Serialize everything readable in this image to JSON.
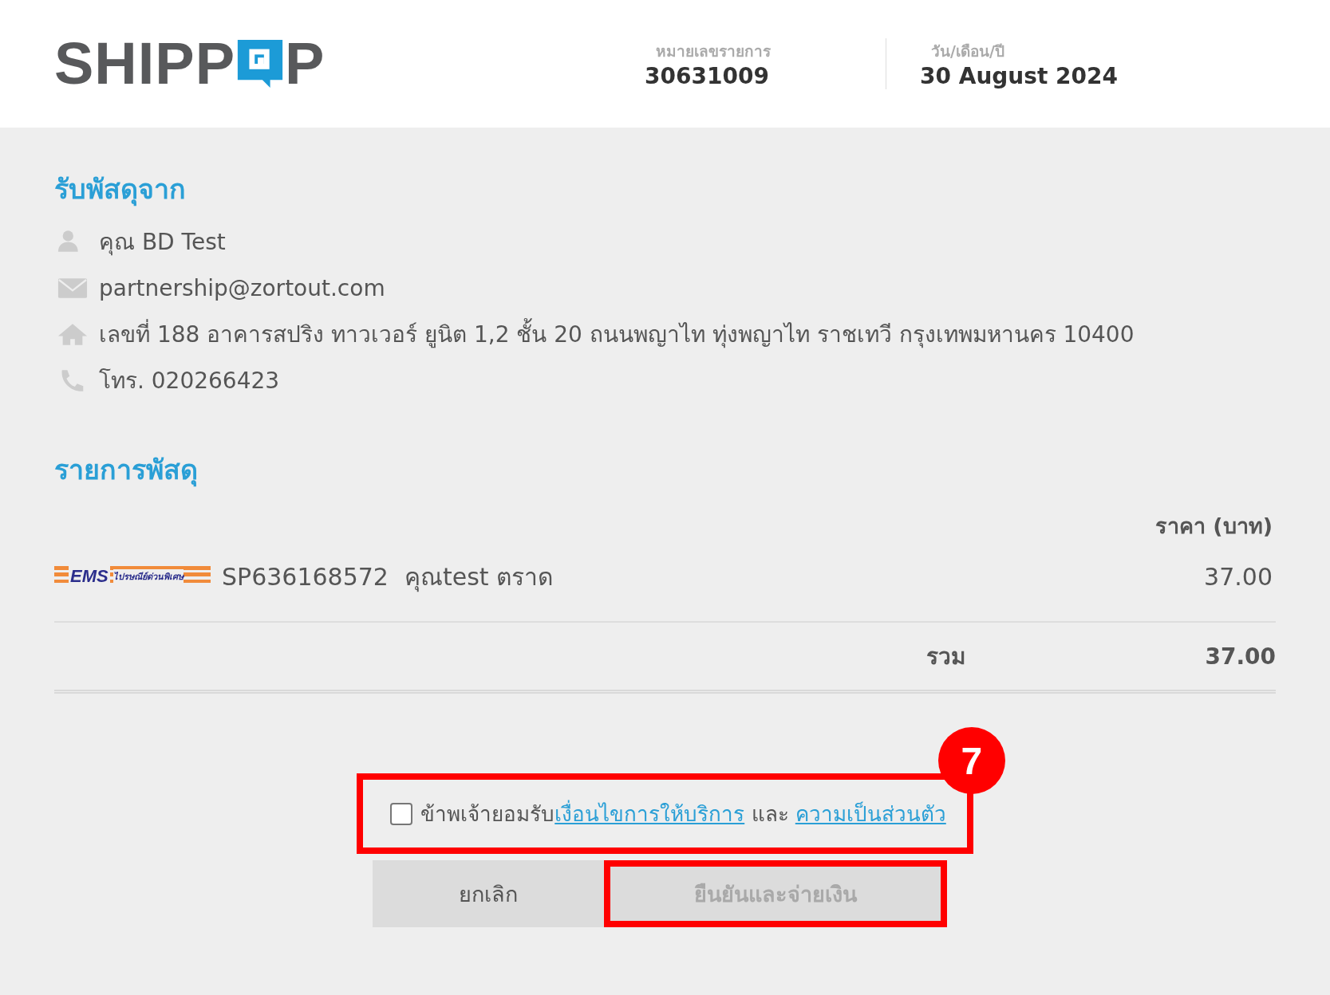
{
  "header": {
    "logo": {
      "before": "SHIPP",
      "after": "P"
    },
    "order": {
      "label": "หมายเลขรายการ",
      "value": "30631009"
    },
    "date": {
      "label": "วัน/เดือน/ปี",
      "value": "30 August 2024"
    }
  },
  "sender": {
    "title": "รับพัสดุจาก",
    "rows": [
      {
        "kind": "person",
        "text": "คุณ BD Test"
      },
      {
        "kind": "email",
        "text": "partnership@zortout.com"
      },
      {
        "kind": "address",
        "text": "เลขที่ 188 อาคารสปริง ทาวเวอร์ ยูนิต 1,2 ชั้น 20 ถนนพญาไท ทุ่งพญาไท ราชเทวี กรุงเทพมหานคร 10400"
      },
      {
        "kind": "phone",
        "text": "โทร. 020266423"
      }
    ]
  },
  "parcels": {
    "title": "รายการพัสดุ",
    "price_header": "ราคา (บาท)",
    "items": [
      {
        "carrier": {
          "mark": "EMS",
          "caption": "ไปรษณีย์ด่วนพิเศษ"
        },
        "tracking": "SP636168572",
        "recipient": "คุณtest ตราด",
        "price": "37.00"
      }
    ],
    "total_label": "รวม",
    "total": "37.00"
  },
  "agreement": {
    "checked": false,
    "highlighted": true,
    "text": "ข้าพเจ้ายอมรับ",
    "terms_link": "เงื่อนไขการให้บริการ",
    "joiner": "และ",
    "privacy_link": "ความเป็นส่วนตัว",
    "badge": "7"
  },
  "buttons": [
    {
      "kind": "cancel",
      "label": "ยกเลิก",
      "disabled": false,
      "highlighted": false
    },
    {
      "kind": "confirm",
      "label": "ยืนยันและจ่ายเงิน",
      "disabled": true,
      "highlighted": true
    }
  ]
}
